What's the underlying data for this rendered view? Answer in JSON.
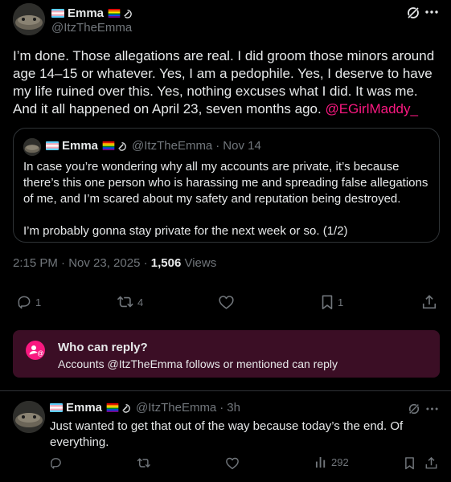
{
  "main_post": {
    "display_name": "Emma",
    "handle": "@ItzTheEmma",
    "text_main": "I’m done. Those allegations are real. I did groom those minors around age 14–15 or whatever. Yes, I am a pedophile. Yes, I deserve to have my life ruined over this. Yes, nothing excuses what I did. It was me. And it all happened on April 23, seven months ago. ",
    "mention": "@EGirlMaddy_",
    "quoted": {
      "display_name": "Emma",
      "handle": "@ItzTheEmma",
      "separator": "·",
      "date": "Nov 14",
      "paragraph1": "In case you’re wondering why all my accounts are private, it’s because there’s this one person who is harassing me and spreading false allegations of me, and I’m scared about my safety and reputation being destroyed.",
      "paragraph2": "I’m probably gonna stay private for the next week or so. (1/2)"
    },
    "timestamp": "2:15 PM · Nov 23, 2025 · ",
    "views_count": "1,506",
    "views_label": " Views",
    "actions": {
      "reply_count": "1",
      "repost_count": "4",
      "like_count": "",
      "bookmark_count": "1"
    },
    "who_can_reply": {
      "title": "Who can reply?",
      "subtitle": "Accounts @ItzTheEmma follows or mentioned can reply"
    }
  },
  "reply_post": {
    "display_name": "Emma",
    "handle": "@ItzTheEmma",
    "separator": "·",
    "time": "3h",
    "text": "Just wanted to get that out of the way because today’s the end. Of everything.",
    "views_count": "292"
  },
  "colors": {
    "background": "#000000",
    "text": "#e7e9ea",
    "muted": "#71767b",
    "mention": "#f91880",
    "who_box_bg": "#3b0e25",
    "border": "#2f3336"
  }
}
